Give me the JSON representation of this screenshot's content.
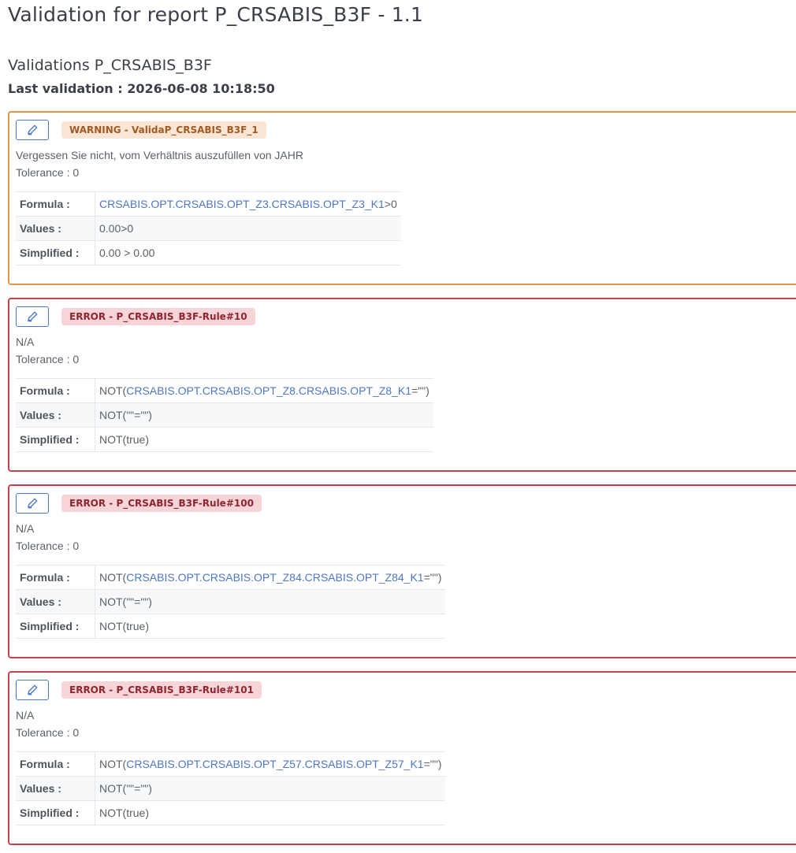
{
  "page": {
    "title": "Validation for report P_CRSABIS_B3F - 1.1",
    "section_title": "Validations P_CRSABIS_B3F",
    "last_validation": "Last validation : 2026-06-08 10:18:50"
  },
  "labels": {
    "formula": "Formula :",
    "values": "Values :",
    "simplified": "Simplified :"
  },
  "colors": {
    "warning_border": "#e0954b",
    "error_border": "#c9424f",
    "link": "#4f76c4",
    "edit_button": "#4a78c9"
  },
  "cards": [
    {
      "severity": "warning",
      "badge": "WARNING - ValidaP_CRSABIS_B3F_1",
      "description": "Vergessen Sie nicht, vom Verhältnis auszufüllen von JAHR",
      "tolerance": "Tolerance : 0",
      "formula_prefix": "",
      "formula_ref": "CRSABIS.OPT.CRSABIS.OPT_Z3.CRSABIS.OPT_Z3_K1",
      "formula_suffix": ">0",
      "values": "0.00>0",
      "simplified": "0.00 > 0.00"
    },
    {
      "severity": "error",
      "badge": "ERROR - P_CRSABIS_B3F-Rule#10",
      "description": "N/A",
      "tolerance": "Tolerance : 0",
      "formula_prefix": "NOT(",
      "formula_ref": "CRSABIS.OPT.CRSABIS.OPT_Z8.CRSABIS.OPT_Z8_K1",
      "formula_suffix": "=\"\")",
      "values": "NOT(\"\"=\"\")",
      "simplified": "NOT(true)"
    },
    {
      "severity": "error",
      "badge": "ERROR - P_CRSABIS_B3F-Rule#100",
      "description": "N/A",
      "tolerance": "Tolerance : 0",
      "formula_prefix": "NOT(",
      "formula_ref": "CRSABIS.OPT.CRSABIS.OPT_Z84.CRSABIS.OPT_Z84_K1",
      "formula_suffix": "=\"\")",
      "values": "NOT(\"\"=\"\")",
      "simplified": "NOT(true)"
    },
    {
      "severity": "error",
      "badge": "ERROR - P_CRSABIS_B3F-Rule#101",
      "description": "N/A",
      "tolerance": "Tolerance : 0",
      "formula_prefix": "NOT(",
      "formula_ref": "CRSABIS.OPT.CRSABIS.OPT_Z57.CRSABIS.OPT_Z57_K1",
      "formula_suffix": "=\"\")",
      "values": "NOT(\"\"=\"\")",
      "simplified": "NOT(true)"
    }
  ]
}
